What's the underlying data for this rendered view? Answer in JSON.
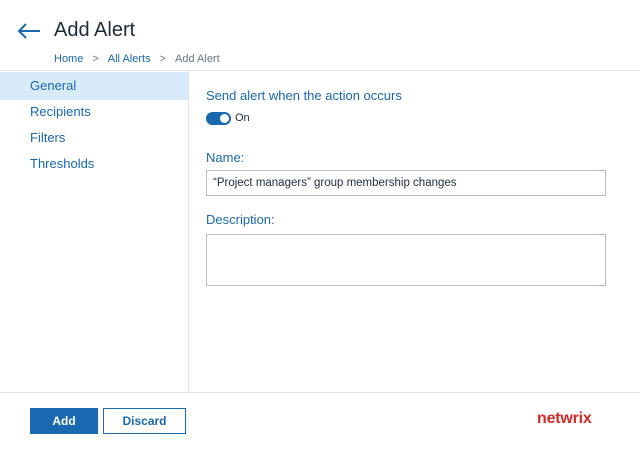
{
  "header": {
    "title": "Add Alert",
    "back_icon": "arrow-left-icon"
  },
  "breadcrumb": {
    "items": [
      "Home",
      "All Alerts",
      "Add Alert"
    ],
    "separator": ">"
  },
  "sidebar": {
    "items": [
      {
        "label": "General",
        "active": true
      },
      {
        "label": "Recipients",
        "active": false
      },
      {
        "label": "Filters",
        "active": false
      },
      {
        "label": "Thresholds",
        "active": false
      }
    ]
  },
  "form": {
    "send_alert_label": "Send alert when the action occurs",
    "toggle_state": "On",
    "toggle_on": true,
    "name_label": "Name:",
    "name_value": "“Project managers” group membership changes",
    "description_label": "Description:",
    "description_value": ""
  },
  "footer": {
    "add_label": "Add",
    "discard_label": "Discard",
    "logo_text": "netwrix"
  },
  "colors": {
    "accent": "#1a68b0",
    "active_bg": "#d8ebf8",
    "logo": "#d42a2a"
  }
}
